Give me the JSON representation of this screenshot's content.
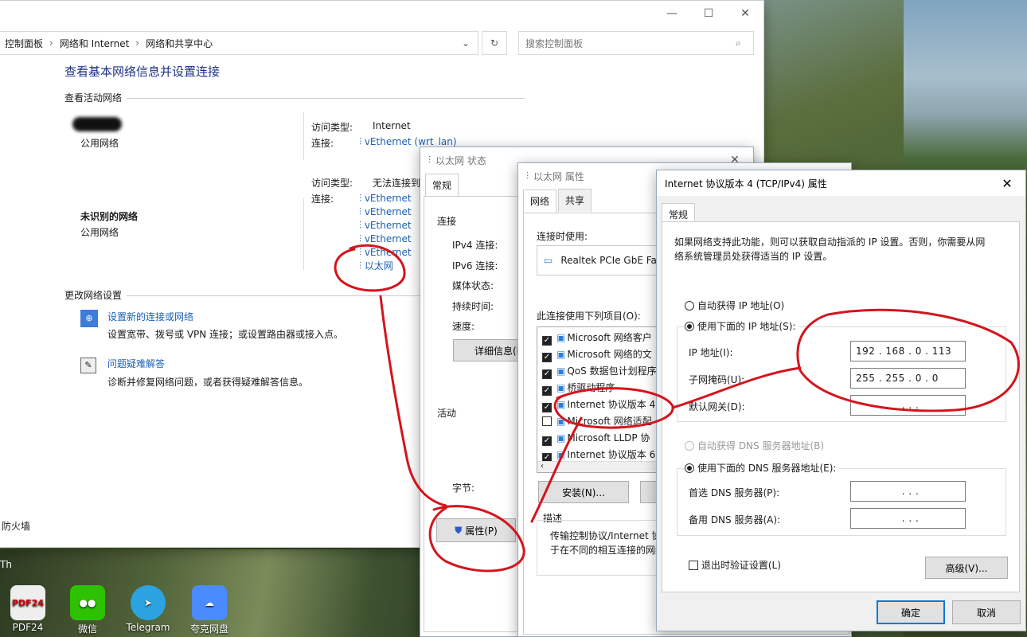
{
  "desktop": {
    "icons": [
      {
        "label": "PDF24",
        "badge": "PDF24",
        "color": "#e8e8e8"
      },
      {
        "label": "微信",
        "badge": "",
        "color": "#2dc100"
      },
      {
        "label": "Telegram",
        "badge": "",
        "color": "#2aa3e0"
      },
      {
        "label": "夸克网盘",
        "badge": "",
        "color": "#4a8cff"
      }
    ],
    "left_edge_label": "Th"
  },
  "control_panel": {
    "breadcrumb": [
      "控制面板",
      "网络和 Internet",
      "网络和共享中心"
    ],
    "search_placeholder": "搜索控制面板",
    "heading": "查看基本网络信息并设置连接",
    "active_networks_title": "查看活动网络",
    "network1": {
      "name": "",
      "type": "公用网络",
      "access_label": "访问类型:",
      "access_value": "Internet",
      "conn_label": "连接:",
      "conn_value": "vEthernet (wrt_lan)"
    },
    "network2": {
      "name": "未识别的网络",
      "type": "公用网络",
      "access_label": "访问类型:",
      "access_value": "无法连接到",
      "conn_label": "连接:",
      "conns": [
        "vEthernet",
        "vEthernet",
        "vEthernet",
        "vEthernet",
        "vEthernet",
        "以太网"
      ]
    },
    "change_settings_title": "更改网络设置",
    "setup_link": "设置新的连接或网络",
    "setup_desc": "设置宽带、拨号或 VPN 连接；或设置路由器或接入点。",
    "troubleshoot_link": "问题疑难解答",
    "troubleshoot_desc": "诊断并修复网络问题，或者获得疑难解答信息。",
    "sidebar_firewall": "防火墙"
  },
  "eth_status": {
    "title": "以太网 状态",
    "tab": "常规",
    "conn_section": "连接",
    "rows": [
      "IPv4 连接:",
      "IPv6 连接:",
      "媒体状态:",
      "持续时间:",
      "速度:"
    ],
    "details_button": "详细信息(E",
    "activity_section": "活动",
    "bytes_label": "字节:",
    "properties_button": "属性(P)"
  },
  "eth_props": {
    "title": "以太网 属性",
    "tabs": [
      "网络",
      "共享"
    ],
    "connect_using_label": "连接时使用:",
    "adapter": "Realtek PCIe GbE Fa",
    "items_label": "此连接使用下列项目(O):",
    "items": [
      {
        "label": "Microsoft 网络客户",
        "checked": true
      },
      {
        "label": "Microsoft 网络的文",
        "checked": true
      },
      {
        "label": "QoS 数据包计划程序",
        "checked": true
      },
      {
        "label": "桥驱动程序",
        "checked": true
      },
      {
        "label": "Internet 协议版本 4",
        "checked": true
      },
      {
        "label": "Microsoft 网络适配",
        "checked": false
      },
      {
        "label": "Microsoft LLDP 协",
        "checked": true
      },
      {
        "label": "Internet 协议版本 6",
        "checked": true
      }
    ],
    "install_button": "安装(N)...",
    "description_label": "描述",
    "description_text_1": "传输控制协议/Internet 协",
    "description_text_2": "于在不同的相互连接的网络"
  },
  "ipv4": {
    "title": "Internet 协议版本 4 (TCP/IPv4) 属性",
    "tab": "常规",
    "intro": "如果网络支持此功能，则可以获取自动指派的 IP 设置。否则，你需要从网络系统管理员处获得适当的 IP 设置。",
    "auto_ip": "自动获得 IP 地址(O)",
    "manual_ip": "使用下面的 IP 地址(S):",
    "ip_label": "IP 地址(I):",
    "ip_value": "192 . 168 .  0  . 113",
    "mask_label": "子网掩码(U):",
    "mask_value": "255 . 255 .  0  .  0",
    "gateway_label": "默认网关(D):",
    "gateway_value": " .     .     . ",
    "auto_dns": "自动获得 DNS 服务器地址(B)",
    "manual_dns": "使用下面的 DNS 服务器地址(E):",
    "dns1_label": "首选 DNS 服务器(P):",
    "dns1_value": " .     .     . ",
    "dns2_label": "备用 DNS 服务器(A):",
    "dns2_value": " .     .     . ",
    "validate": "退出时验证设置(L)",
    "advanced_button": "高级(V)...",
    "ok_button": "确定",
    "cancel_button": "取消"
  }
}
